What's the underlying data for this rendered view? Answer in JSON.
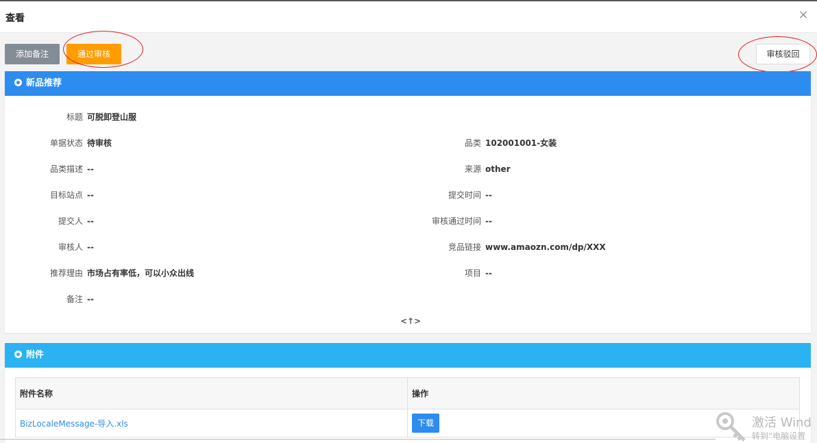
{
  "dialog": {
    "title": "查看",
    "close_glyph": "×"
  },
  "toolbar": {
    "add_note_label": "添加备注",
    "approve_label": "通过审核",
    "reject_label": "审核驳回"
  },
  "main_panel": {
    "title": "新品推荐",
    "icon": "wordpress-icon",
    "fields": {
      "title": {
        "label": "标题",
        "value": "可脱卸登山服"
      },
      "status": {
        "label": "单据状态",
        "value": "待审核"
      },
      "category": {
        "label": "品类",
        "value": "102001001-女装"
      },
      "category_desc": {
        "label": "品类描述",
        "value": "--"
      },
      "source": {
        "label": "来源",
        "value": "other"
      },
      "target_site": {
        "label": "目标站点",
        "value": "--"
      },
      "submit_time": {
        "label": "提交时间",
        "value": "--"
      },
      "submitter": {
        "label": "提交人",
        "value": "--"
      },
      "approve_time": {
        "label": "审核通过时间",
        "value": "--"
      },
      "reviewer": {
        "label": "审核人",
        "value": "--"
      },
      "competitor_link": {
        "label": "竞品链接",
        "value": "www.amaozn.com/dp/XXX"
      },
      "reason": {
        "label": "推荐理由",
        "value": "市场占有率低，可以小众出线"
      },
      "project": {
        "label": "项目",
        "value": "--"
      },
      "remark": {
        "label": "备注",
        "value": "--"
      }
    },
    "collapse_glyph": "<↑>"
  },
  "attach_panel": {
    "title": "附件",
    "icon": "wordpress-icon",
    "columns": [
      "附件名称",
      "操作"
    ],
    "rows": [
      {
        "name": "BizLocaleMessage-导入.xls",
        "action": "下载"
      }
    ]
  },
  "watermark": {
    "line1": "激活 Wind",
    "line2": "转到“电脑设置"
  },
  "colors": {
    "primary": "#2d8cf0",
    "attach_header": "#2bb2f2",
    "approve": "#ff9d00",
    "note_button": "#848c96",
    "annotation": "#e21b1b"
  }
}
